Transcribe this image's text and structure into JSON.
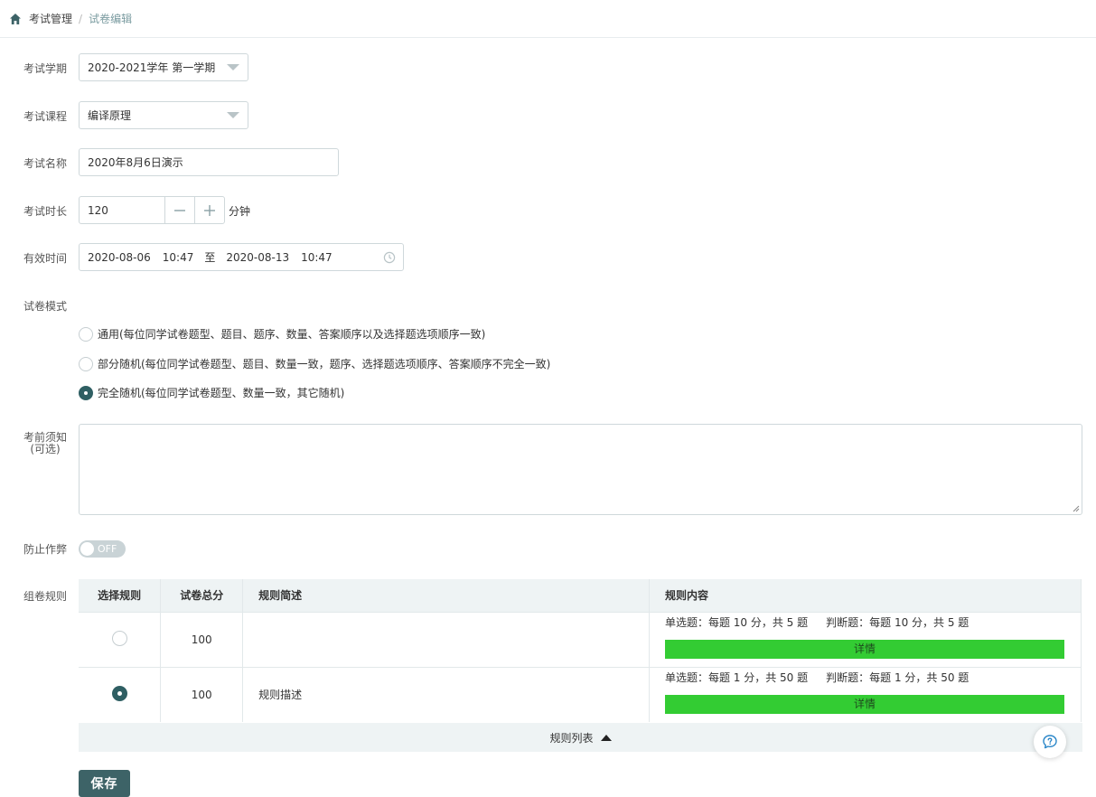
{
  "breadcrumb": {
    "items": [
      "考试管理",
      "试卷编辑"
    ],
    "separator": "/"
  },
  "form": {
    "term": {
      "label": "考试学期",
      "value": "2020-2021学年 第一学期"
    },
    "course": {
      "label": "考试课程",
      "value": "编译原理"
    },
    "name": {
      "label": "考试名称",
      "value": "2020年8月6日演示"
    },
    "duration": {
      "label": "考试时长",
      "value": "120",
      "unit": "分钟"
    },
    "valid_time": {
      "label": "有效时间",
      "start_date": "2020-08-06",
      "start_time": "10:47",
      "to": "至",
      "end_date": "2020-08-13",
      "end_time": "10:47"
    },
    "mode": {
      "label": "试卷模式",
      "options": [
        {
          "label": "通用(每位同学试卷题型、题目、题序、数量、答案顺序以及选择题选项顺序一致)",
          "selected": false
        },
        {
          "label": "部分随机(每位同学试卷题型、题目、数量一致，题序、选择题选项顺序、答案顺序不完全一致)",
          "selected": false
        },
        {
          "label": "完全随机(每位同学试卷题型、数量一致，其它随机)",
          "selected": true
        }
      ]
    },
    "notice": {
      "label": "考前须知",
      "sublabel": "(可选)",
      "value": ""
    },
    "anti_cheat": {
      "label": "防止作弊",
      "state": "OFF"
    },
    "rules": {
      "label": "组卷规则",
      "columns": [
        "选择规则",
        "试卷总分",
        "规则简述",
        "规则内容"
      ],
      "rows": [
        {
          "selected": false,
          "total": "100",
          "summary": "",
          "content": [
            "单选题：每题 10 分，共 5 题",
            "判断题：每题 10 分，共 5 题"
          ],
          "detail": "详情"
        },
        {
          "selected": true,
          "total": "100",
          "summary": "规则描述",
          "content": [
            "单选题：每题 1 分，共 50 题",
            "判断题：每题 1 分，共 50 题"
          ],
          "detail": "详情"
        }
      ],
      "footer": "规则列表"
    }
  },
  "actions": {
    "save": "保存"
  },
  "colors": {
    "primary": "#3d6367",
    "detail_bar": "#33cc33",
    "table_header": "#eef3f4"
  }
}
